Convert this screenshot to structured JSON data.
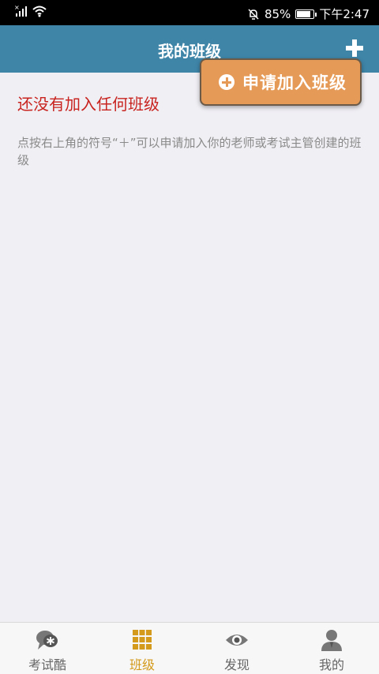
{
  "status_bar": {
    "battery": "85%",
    "time": "下午2:47",
    "battery_level": 0.85
  },
  "header": {
    "title": "我的班级"
  },
  "popup_menu": {
    "item_label": "申请加入班级"
  },
  "content": {
    "empty_title": "还没有加入任何班级",
    "empty_desc": "点按右上角的符号“＋”可以申请加入你的老师或考试主管创建的班级"
  },
  "bottom_nav": {
    "items": [
      {
        "label": "考试酷",
        "icon": "chat-bubble-icon"
      },
      {
        "label": "班级",
        "icon": "grid-icon",
        "active": true
      },
      {
        "label": "发现",
        "icon": "eye-icon"
      },
      {
        "label": "我的",
        "icon": "user-icon"
      }
    ]
  },
  "colors": {
    "header": "#3f85a8",
    "popup": "#e59a57",
    "empty_title": "#c8231f",
    "nav_active": "#d39a1c"
  }
}
